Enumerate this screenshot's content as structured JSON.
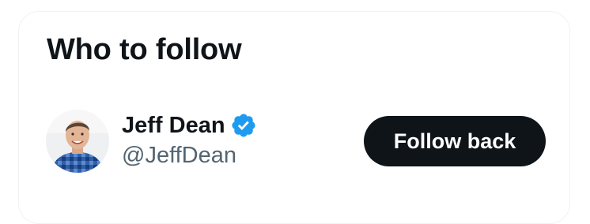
{
  "widget": {
    "title": "Who to follow"
  },
  "suggestions": [
    {
      "name": "Jeff Dean",
      "handle": "@JeffDean",
      "verified": true,
      "avatar_icon": "profile-photo",
      "action_label": "Follow back"
    }
  ],
  "colors": {
    "text_primary": "#0f1419",
    "text_secondary": "#536471",
    "verified_badge": "#1d9bf0",
    "button_bg": "#0f1419",
    "button_text": "#ffffff",
    "card_border": "#eff3f4"
  }
}
